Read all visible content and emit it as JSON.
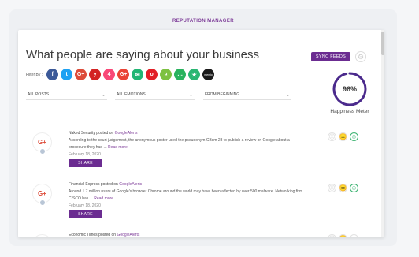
{
  "app": {
    "title": "REPUTATION MANAGER"
  },
  "main": {
    "headline": "What people are saying about your business",
    "sync_label": "SYNC FEEDS",
    "filter_label": "Filter By :",
    "filters": [
      {
        "name": "facebook",
        "glyph": "f",
        "color": "#3b5998"
      },
      {
        "name": "twitter",
        "glyph": "t",
        "color": "#1da1f2"
      },
      {
        "name": "google-plus",
        "glyph": "G+",
        "color": "#dd4b39"
      },
      {
        "name": "yelp",
        "glyph": "y",
        "color": "#d32323"
      },
      {
        "name": "foursquare",
        "glyph": "4",
        "color": "#f94877"
      },
      {
        "name": "google-alerts",
        "glyph": "G+",
        "color": "#ea4335"
      },
      {
        "name": "email",
        "glyph": "✉",
        "color": "#21b573"
      },
      {
        "name": "tripadvisor",
        "glyph": "o",
        "color": "#e21e26"
      },
      {
        "name": "trust",
        "glyph": "¤",
        "color": "#7dc141"
      },
      {
        "name": "chat",
        "glyph": "…",
        "color": "#29b35e"
      },
      {
        "name": "favorites",
        "glyph": "★",
        "color": "#2ab673"
      },
      {
        "name": "mentio",
        "glyph": "mentio",
        "color": "#1a1a1a"
      }
    ],
    "dropdowns": [
      {
        "value": "ALL POSTS"
      },
      {
        "value": "ALL EMOTIONS"
      },
      {
        "value": "FROM BEGINNING"
      }
    ],
    "meter": {
      "value": "96%",
      "percent": 96,
      "label": "Happiness Meter"
    }
  },
  "posts": [
    {
      "author": "Naked Security",
      "posted_on": "posted on",
      "source": "GoogleAlerts",
      "text": "According to the court judgement, the anonymous poster used the pseudonym CBsm 23 to publish a review on Google about a procedure they had ...",
      "read_more": "Read more",
      "date": "February 18, 2020",
      "share_label": "SHARE"
    },
    {
      "author": "Financial Express",
      "posted_on": "posted on",
      "source": "GoogleAlerts",
      "text": "Around 1.7 million users of Google's browser Chrome around the world may have been affected by over 500 malware. Networking firm CISCO has ...",
      "read_more": "Read more",
      "date": "February 18, 2020",
      "share_label": "SHARE"
    },
    {
      "author": "Economic Times",
      "posted_on": "posted on",
      "source": "GoogleAlerts"
    }
  ],
  "sentiment_icons": {
    "negative": "☹",
    "neutral": "😐",
    "positive": "☺",
    "active_color": "#3cb371"
  }
}
